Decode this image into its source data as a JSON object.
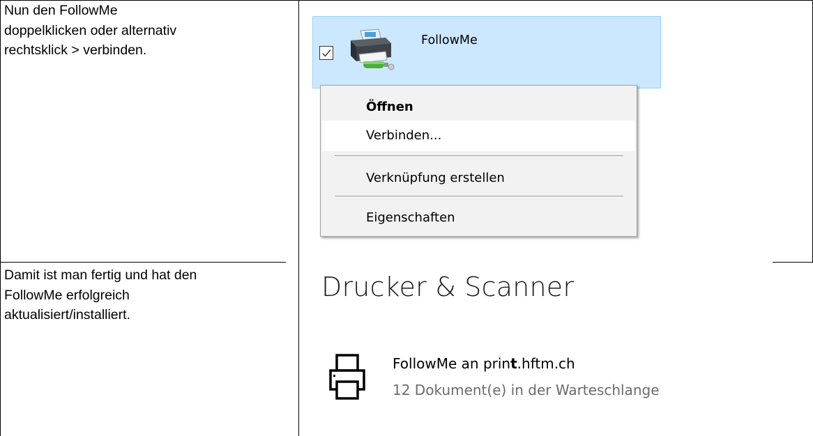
{
  "rows": [
    {
      "instruction_lines": [
        "Nun den FollowMe",
        "doppelklicken oder alternativ",
        "rechtsklick > verbinden."
      ]
    },
    {
      "instruction_lines": [
        "Damit ist man fertig und hat den",
        "FollowMe erfolgreich",
        "aktualisiert/installiert."
      ]
    }
  ],
  "explorer_item": {
    "label": "FollowMe",
    "checked": true,
    "icon": "network-printer-icon",
    "selection_color": "#cce8ff"
  },
  "context_menu": {
    "items": [
      {
        "label": "Öffnen",
        "bold": true
      },
      {
        "label": "Verbinden...",
        "highlighted": true
      },
      {
        "label": "Verknüpfung erstellen"
      },
      {
        "label": "Eigenschaften"
      }
    ]
  },
  "settings": {
    "heading": "Drucker & Scanner",
    "printer": {
      "name_prefix": "FollowMe an prin",
      "name_bold": "t",
      "name_suffix": ".hftm.ch",
      "status": "12 Dokument(e) in der Warteschlange",
      "icon": "printer-icon"
    }
  }
}
